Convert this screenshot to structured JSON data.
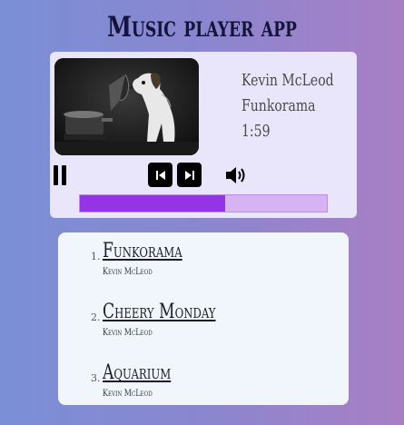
{
  "app": {
    "title": "Music player app"
  },
  "now_playing": {
    "artist": "Kevin McLeod",
    "title": "Funkorama",
    "time": "1:59",
    "progress": 0.59,
    "icons": [
      "pause-icon",
      "previous-icon",
      "next-icon",
      "volume-icon"
    ]
  },
  "playlist": {
    "tracks": [
      {
        "number": "1.",
        "title": "Funkorama",
        "artist": "Kevin McLeod"
      },
      {
        "number": "2.",
        "title": "Cheery Monday",
        "artist": "Kevin McLeod"
      },
      {
        "number": "3.",
        "title": "Aquarium",
        "artist": "Kevin McLeod"
      }
    ]
  }
}
